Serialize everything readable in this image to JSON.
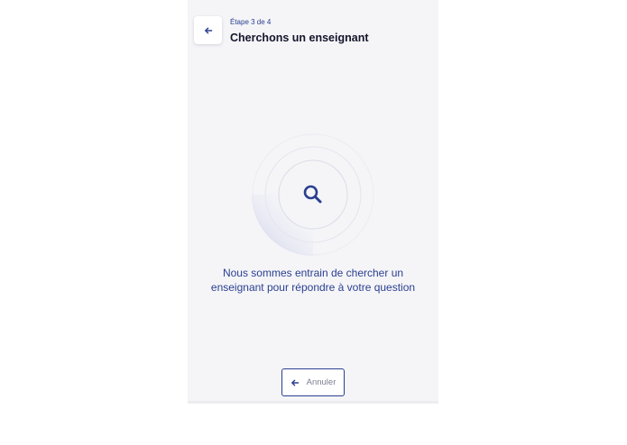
{
  "header": {
    "step_label": "Étape 3 de 4",
    "title": "Cherchons un enseignant",
    "back_icon": "arrow-left-icon"
  },
  "searching": {
    "icon": "search-icon",
    "message_line_1": "Nous sommes entrain de chercher un",
    "message_line_2": "enseignant pour répondre à votre question"
  },
  "footer": {
    "cancel_label": "Annuler",
    "cancel_icon": "arrow-left-icon"
  },
  "colors": {
    "accent": "#2a3f8f",
    "title": "#14142b",
    "panel_background": "#f5f5f8",
    "muted_text": "#7b7f94"
  }
}
